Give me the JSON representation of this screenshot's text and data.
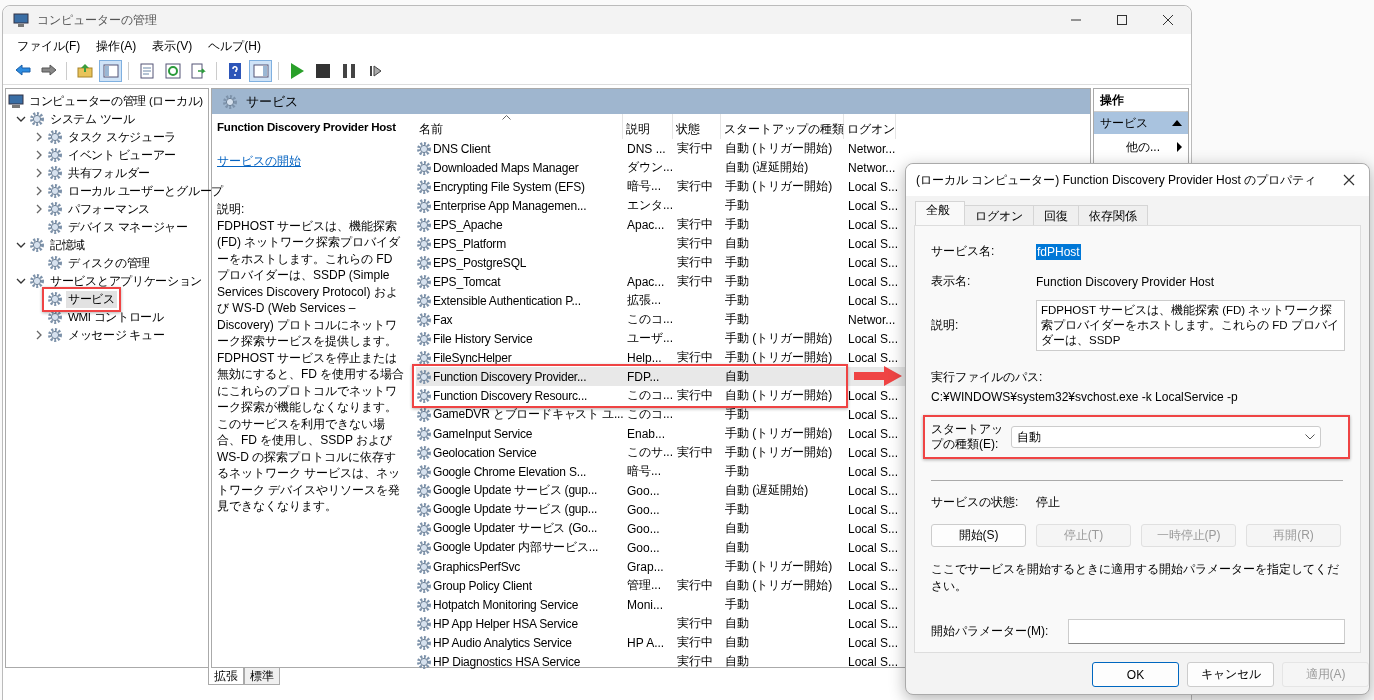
{
  "window": {
    "title": "コンピューターの管理"
  },
  "menu": [
    "ファイル(F)",
    "操作(A)",
    "表示(V)",
    "ヘルプ(H)"
  ],
  "toolbar": [
    {
      "kind": "back",
      "pressed": false
    },
    {
      "kind": "forward",
      "pressed": false
    },
    {
      "kind": "separator"
    },
    {
      "kind": "up",
      "pressed": false
    },
    {
      "kind": "tree",
      "pressed": true
    },
    {
      "kind": "separator"
    },
    {
      "kind": "properties",
      "pressed": false
    },
    {
      "kind": "refresh",
      "pressed": false
    },
    {
      "kind": "export",
      "pressed": false
    },
    {
      "kind": "separator"
    },
    {
      "kind": "help",
      "pressed": false
    },
    {
      "kind": "pane",
      "pressed": true
    },
    {
      "kind": "separator"
    },
    {
      "kind": "start",
      "pressed": false
    },
    {
      "kind": "stop",
      "pressed": false
    },
    {
      "kind": "pause",
      "pressed": false
    },
    {
      "kind": "resume",
      "pressed": false
    }
  ],
  "tree": [
    {
      "label": "コンピューターの管理 (ローカル)",
      "selected": false,
      "children": [
        {
          "label": "システム ツール",
          "selected": false,
          "expanded": true,
          "children": [
            {
              "label": "タスク スケジューラ",
              "selected": false,
              "expanded": false
            },
            {
              "label": "イベント ビューアー",
              "selected": false,
              "expanded": false
            },
            {
              "label": "共有フォルダー",
              "selected": false,
              "expanded": false
            },
            {
              "label": "ローカル ユーザーとグループ",
              "selected": false,
              "expanded": false
            },
            {
              "label": "パフォーマンス",
              "selected": false,
              "expanded": false
            },
            {
              "label": "デバイス マネージャー",
              "selected": false
            }
          ]
        },
        {
          "label": "記憶域",
          "selected": false,
          "expanded": true,
          "children": [
            {
              "label": "ディスクの管理",
              "selected": false
            }
          ]
        },
        {
          "label": "サービスとアプリケーション",
          "selected": false,
          "expanded": true,
          "children": [
            {
              "label": "サービス",
              "selected": true
            },
            {
              "label": "WMI コントロール",
              "selected": false
            },
            {
              "label": "メッセージ キュー",
              "selected": false,
              "expanded": false
            }
          ]
        }
      ]
    }
  ],
  "details": {
    "header": "サービス",
    "service_title": "Function Discovery Provider Host",
    "link": "サービスの開始",
    "description_label": "説明:",
    "description": "FDPHOST サービスは、機能探索 (FD) ネットワーク探索プロバイダーをホストします。これらの FD プロバイダーは、SSDP (Simple Services Discovery Protocol) および WS-D (Web Services – Discovery) プロトコルにネットワーク探索サービスを提供します。FDPHOST サービスを停止または無効にすると、FD を使用する場合にこれらのプロトコルでネットワーク探索が機能しなくなります。このサービスを利用できない場合、FD を使用し、SSDP および WS-D の探索プロトコルに依存するネットワーク サービスは、ネットワーク デバイスやリソースを発見できなくなります。"
  },
  "services": {
    "columns": [
      "名前",
      "説明",
      "状態",
      "スタートアップの種類",
      "ログオン"
    ],
    "rows": [
      {
        "name": "DNS Client",
        "description": "DNS ...",
        "status": "実行中",
        "startup": "自動 (トリガー開始)",
        "logon": "Networ...",
        "selected": false
      },
      {
        "name": "Downloaded Maps Manager",
        "description": "ダウン...",
        "startup": "自動 (遅延開始)",
        "logon": "Networ...",
        "selected": false
      },
      {
        "name": "Encrypting File System (EFS)",
        "description": "暗号...",
        "status": "実行中",
        "startup": "手動 (トリガー開始)",
        "logon": "Local S...",
        "selected": false
      },
      {
        "name": "Enterprise App Managemen...",
        "description": "エンタ...",
        "startup": "手動",
        "logon": "Local S...",
        "selected": false
      },
      {
        "name": "EPS_Apache",
        "description": "Apac...",
        "status": "実行中",
        "startup": "手動",
        "logon": "Local S...",
        "selected": false
      },
      {
        "name": "EPS_Platform",
        "status": "実行中",
        "startup": "自動",
        "logon": "Local S...",
        "selected": false
      },
      {
        "name": "EPS_PostgreSQL",
        "status": "実行中",
        "startup": "手動",
        "logon": "Local S...",
        "selected": false
      },
      {
        "name": "EPS_Tomcat",
        "description": "Apac...",
        "status": "実行中",
        "startup": "手動",
        "logon": "Local S...",
        "selected": false
      },
      {
        "name": "Extensible Authentication P...",
        "description": "拡張...",
        "startup": "手動",
        "logon": "Local S...",
        "selected": false
      },
      {
        "name": "Fax",
        "description": "このコ...",
        "startup": "手動",
        "logon": "Networ...",
        "selected": false
      },
      {
        "name": "File History Service",
        "description": "ユーザ...",
        "startup": "手動 (トリガー開始)",
        "logon": "Local S...",
        "selected": false
      },
      {
        "name": "FileSyncHelper",
        "description": "Help...",
        "status": "実行中",
        "startup": "手動 (トリガー開始)",
        "logon": "Local S...",
        "selected": false
      },
      {
        "name": "Function Discovery Provider...",
        "description": "FDP...",
        "startup": "自動",
        "selected": true
      },
      {
        "name": "Function Discovery Resourc...",
        "description": "このコ...",
        "status": "実行中",
        "startup": "自動 (トリガー開始)",
        "logon": "Local S...",
        "selected": false
      },
      {
        "name": "GameDVR とブロードキャスト ユ...",
        "description": "このコ...",
        "startup": "手動",
        "logon": "Local S...",
        "selected": false
      },
      {
        "name": "GameInput Service",
        "description": "Enab...",
        "startup": "手動 (トリガー開始)",
        "logon": "Local S...",
        "selected": false
      },
      {
        "name": "Geolocation Service",
        "description": "このサ...",
        "status": "実行中",
        "startup": "手動 (トリガー開始)",
        "logon": "Local S...",
        "selected": false
      },
      {
        "name": "Google Chrome Elevation S...",
        "description": "暗号...",
        "startup": "手動",
        "logon": "Local S...",
        "selected": false
      },
      {
        "name": "Google Update サービス (gup...",
        "description": "Goo...",
        "startup": "自動 (遅延開始)",
        "logon": "Local S...",
        "selected": false
      },
      {
        "name": "Google Update サービス (gup...",
        "description": "Goo...",
        "startup": "手動",
        "logon": "Local S...",
        "selected": false
      },
      {
        "name": "Google Updater サービス (Go...",
        "description": "Goo...",
        "startup": "自動",
        "logon": "Local S...",
        "selected": false
      },
      {
        "name": "Google Updater 内部サービス...",
        "description": "Goo...",
        "startup": "自動",
        "logon": "Local S...",
        "selected": false
      },
      {
        "name": "GraphicsPerfSvc",
        "description": "Grap...",
        "startup": "手動 (トリガー開始)",
        "logon": "Local S...",
        "selected": false
      },
      {
        "name": "Group Policy Client",
        "description": "管理...",
        "status": "実行中",
        "startup": "自動 (トリガー開始)",
        "logon": "Local S...",
        "selected": false
      },
      {
        "name": "Hotpatch Monitoring Service",
        "description": "Moni...",
        "startup": "手動",
        "logon": "Local S...",
        "selected": false
      },
      {
        "name": "HP App Helper HSA Service",
        "status": "実行中",
        "startup": "自動",
        "logon": "Local S...",
        "selected": false
      },
      {
        "name": "HP Audio Analytics Service",
        "description": "HP A...",
        "status": "実行中",
        "startup": "自動",
        "logon": "Local S...",
        "selected": false
      },
      {
        "name": "HP Diagnostics HSA Service",
        "status": "実行中",
        "startup": "自動",
        "logon": "Local S...",
        "selected": false
      }
    ]
  },
  "actions": {
    "header": "操作",
    "section": "サービス",
    "items": [
      "他の..."
    ]
  },
  "view_tabs": [
    {
      "label": "拡張",
      "selected": true
    },
    {
      "label": "標準",
      "selected": false
    }
  ],
  "dialog": {
    "title": "(ローカル コンピューター) Function Discovery Provider Host のプロパティ",
    "tabs": [
      {
        "label": "全般",
        "selected": true
      },
      {
        "label": "ログオン",
        "selected": false
      },
      {
        "label": "回復",
        "selected": false
      },
      {
        "label": "依存関係",
        "selected": false
      }
    ],
    "service_name_label": "サービス名:",
    "service_name": "fdPHost",
    "display_name_label": "表示名:",
    "display_name": "Function Discovery Provider Host",
    "description_label": "説明:",
    "description": "FDPHOST サービスは、機能探索 (FD) ネットワーク探索プロバイダーをホストします。これらの FD プロバイダーは、SSDP",
    "path_label": "実行ファイルのパス:",
    "path": "C:¥WINDOWS¥system32¥svchost.exe -k LocalService -p",
    "startup_label": "スタートアップの種類(E):",
    "startup_value": "自動",
    "status_label": "サービスの状態:",
    "status": "停止",
    "control_buttons": [
      {
        "label": "開始(S)",
        "disabled": false
      },
      {
        "label": "停止(T)",
        "disabled": true
      },
      {
        "label": "一時停止(P)",
        "disabled": true
      },
      {
        "label": "再開(R)",
        "disabled": true
      }
    ],
    "hint": "ここでサービスを開始するときに適用する開始パラメーターを指定してください。",
    "params_label": "開始パラメーター(M):",
    "buttons": [
      {
        "label": "OK",
        "default": true,
        "disabled": false
      },
      {
        "label": "キャンセル",
        "default": false,
        "disabled": false
      },
      {
        "label": "適用(A)",
        "default": false,
        "disabled": true
      }
    ]
  }
}
